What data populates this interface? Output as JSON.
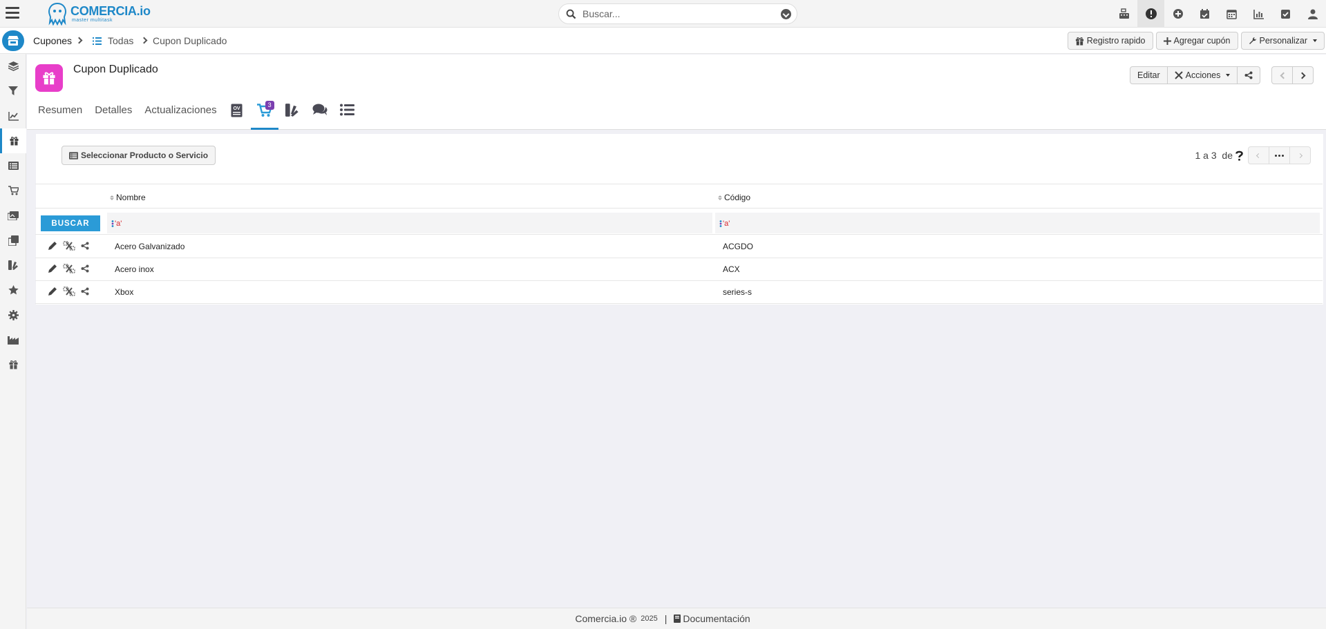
{
  "app": {
    "logo_name": "COMERCIA",
    "logo_ext": ".io",
    "logo_tagline": "master multitask"
  },
  "search": {
    "placeholder": "Buscar..."
  },
  "top_icons": [
    "cash-register-icon",
    "alert-icon",
    "plus-circle-icon",
    "calendar-check-icon",
    "calendar-icon",
    "bar-chart-icon",
    "checkbox-icon",
    "user-icon"
  ],
  "breadcrumb": {
    "root": "Cupones",
    "list": "Todas",
    "current": "Cupon Duplicado"
  },
  "toolbar": {
    "quick_register": "Registro rapido",
    "add_coupon": "Agregar cupón",
    "customize": "Personalizar"
  },
  "sidebar": [
    "layers-icon",
    "filter-icon",
    "chart-line-icon",
    "gift-icon",
    "list-icon",
    "cart-icon",
    "images-icon",
    "copy-icon",
    "swatch-icon",
    "star-icon",
    "gear-icon",
    "industry-icon",
    "gift-icon"
  ],
  "record": {
    "title": "Cupon Duplicado",
    "edit": "Editar",
    "actions": "Acciones"
  },
  "tabs": {
    "summary": "Resumen",
    "details": "Detalles",
    "updates": "Actualizaciones",
    "cart_badge": "3"
  },
  "panel": {
    "select_button": "Seleccionar Producto o Servicio",
    "pager_text": "1 a 3  de",
    "columns": {
      "name": "Nombre",
      "code": "Código"
    },
    "search_button": "BUSCAR",
    "filter_hint": "'a'",
    "rows": [
      {
        "name": "Acero Galvanizado",
        "code": "ACGDO"
      },
      {
        "name": "Acero inox",
        "code": "ACX"
      },
      {
        "name": "Xbox",
        "code": "series-s"
      }
    ]
  },
  "footer": {
    "brand": "Comercia.io ®",
    "year": "2025",
    "separator": "|",
    "docs": "Documentación"
  },
  "colors": {
    "accent": "#1e88c8",
    "record_icon": "#e83ec9",
    "badge": "#7b3fb0",
    "search_button": "#2b9bd7"
  }
}
